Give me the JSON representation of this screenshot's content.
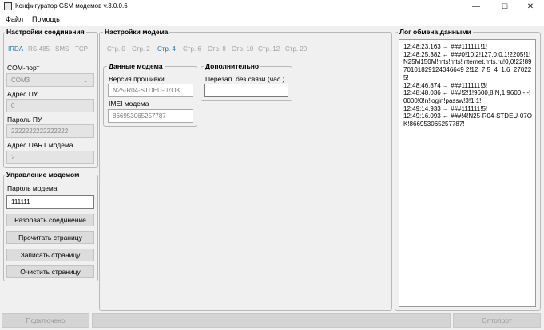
{
  "window": {
    "title": "Конфигуратор GSM модемов v.3.0.0.6",
    "minimize": "—",
    "maximize": "☐",
    "close": "✕"
  },
  "menu": {
    "file": "Файл",
    "help": "Помощь"
  },
  "connection": {
    "title": "Настройки соединения",
    "tabs": [
      "IRDA",
      "RS-485",
      "SMS",
      "TCP"
    ],
    "active_tab": "IRDA",
    "com_port_label": "COM-порт",
    "com_port_value": "COM3",
    "address_label": "Адрес ПУ",
    "address_value": "0",
    "password_label": "Пароль ПУ",
    "password_value": "2222222222222222",
    "uart_label": "Адрес UART модема",
    "uart_value": "2"
  },
  "control": {
    "title": "Управление модемом",
    "password_label": "Пароль модема",
    "password_value": "111111",
    "btn_disconnect": "Разорвать соединение",
    "btn_read": "Прочитать страницу",
    "btn_write": "Записать страницу",
    "btn_clear": "Очистить страницу"
  },
  "modem": {
    "title": "Настройки модема",
    "pages": [
      "Стр. 0",
      "Стр. 2",
      "Стр. 4",
      "Стр. 6",
      "Стр. 8",
      "Стр. 10",
      "Стр. 12",
      "Стр. 20"
    ],
    "active_page": "Стр. 4",
    "data_title": "Данные модема",
    "firmware_label": "Версия прошивки",
    "firmware_value": "N25-R04-STDEU-07OK",
    "imei_label": "IMEI модема",
    "imei_value": "866953065257787",
    "extra_title": "Дополнительно",
    "reconnect_label": "Перезап. без связи (час.)",
    "reconnect_value": ""
  },
  "log": {
    "title": "Лог обмена данными",
    "text": "12:48:23.163 → ###111111!1!\n12:48:25.382 ← ###0!10!2!127.0.0.1!2205!1!N25M150M!mts!mts!internet.mts.ru!0,0!22!8970101829124046649 2!12_7.5_4_1.6_270225!\n12:48:46.874 → ###111111!3!\n12:48:48.036 ← ###!2!1!9600,8,N,1!9600!-,-!0000!0!n!login!passw!3!1!1!\n12:49:14.933 → ###111111!5!\n12:49:16.093 ← ###!4!N25-R04-STDEU-07OK!866953065257787!"
  },
  "status": {
    "left": "Подключено",
    "right": "Оптопорт"
  }
}
